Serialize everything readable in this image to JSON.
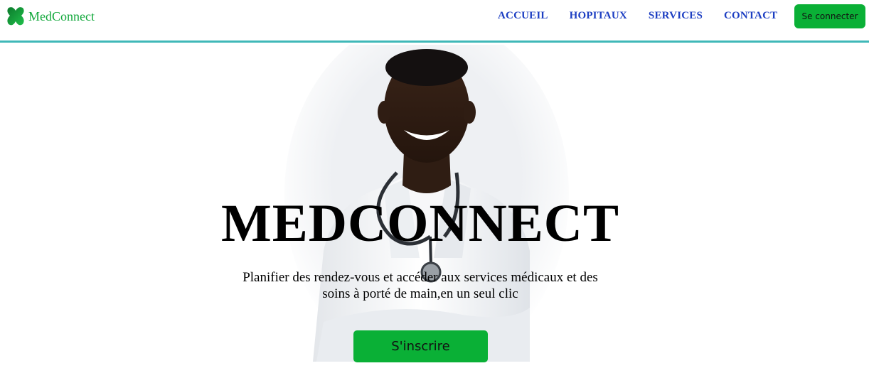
{
  "brand": {
    "name": "MedConnect",
    "logo_icon": "green-cross-logo-icon"
  },
  "nav": {
    "links": [
      {
        "label": "ACCUEIL"
      },
      {
        "label": "HOPITAUX"
      },
      {
        "label": "SERVICES"
      },
      {
        "label": "CONTACT"
      }
    ],
    "login_label": "Se connecter"
  },
  "hero": {
    "title": "MEDCONNECT",
    "subtitle": "Planifier des rendez-vous et accéder aux services médicaux et des soins à porté de main,en un seul clic",
    "cta_label": "S'inscrire",
    "image": "doctor-photo"
  },
  "colors": {
    "brand_green": "#13a83c",
    "button_green": "#0ab036",
    "nav_blue": "#1c3ec2",
    "header_border": "#3fb8b8"
  }
}
